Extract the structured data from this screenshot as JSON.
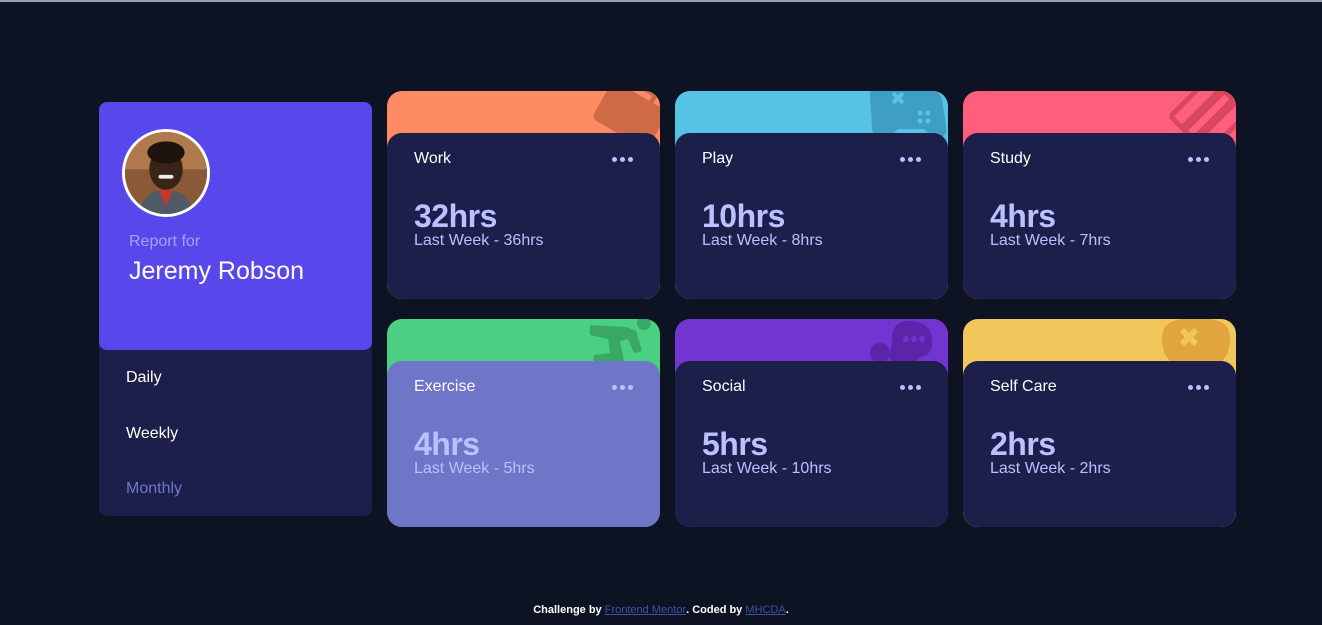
{
  "profile": {
    "report_for": "Report for",
    "name": "Jeremy Robson",
    "periods": [
      "Daily",
      "Weekly",
      "Monthly"
    ]
  },
  "cards": [
    {
      "title": "Work",
      "current": "32hrs",
      "previous": "Last Week - 36hrs",
      "color": "#ff8b64",
      "icon": "work-icon"
    },
    {
      "title": "Play",
      "current": "10hrs",
      "previous": "Last Week - 8hrs",
      "color": "#55c2e6",
      "icon": "play-icon"
    },
    {
      "title": "Study",
      "current": "4hrs",
      "previous": "Last Week - 7hrs",
      "color": "#ff5e7d",
      "icon": "study-icon"
    },
    {
      "title": "Exercise",
      "current": "4hrs",
      "previous": "Last Week - 5hrs",
      "color": "#4bcf82",
      "icon": "exercise-icon"
    },
    {
      "title": "Social",
      "current": "5hrs",
      "previous": "Last Week - 10hrs",
      "color": "#7335d2",
      "icon": "social-icon"
    },
    {
      "title": "Self Care",
      "current": "2hrs",
      "previous": "Last Week - 2hrs",
      "color": "#f1c75b",
      "icon": "self-care-icon"
    }
  ],
  "footer": {
    "challenge_by": "Challenge by",
    "frontend_mentor": "Frontend Mentor",
    "coded_by": ". Coded by",
    "author": "MHCDA",
    "end": "."
  },
  "colors": {
    "background": "#0e1323",
    "card": "#1c1f4a",
    "accent": "#5847eb",
    "hover": "#6f76c8",
    "pale_blue": "#bbc0ff"
  }
}
